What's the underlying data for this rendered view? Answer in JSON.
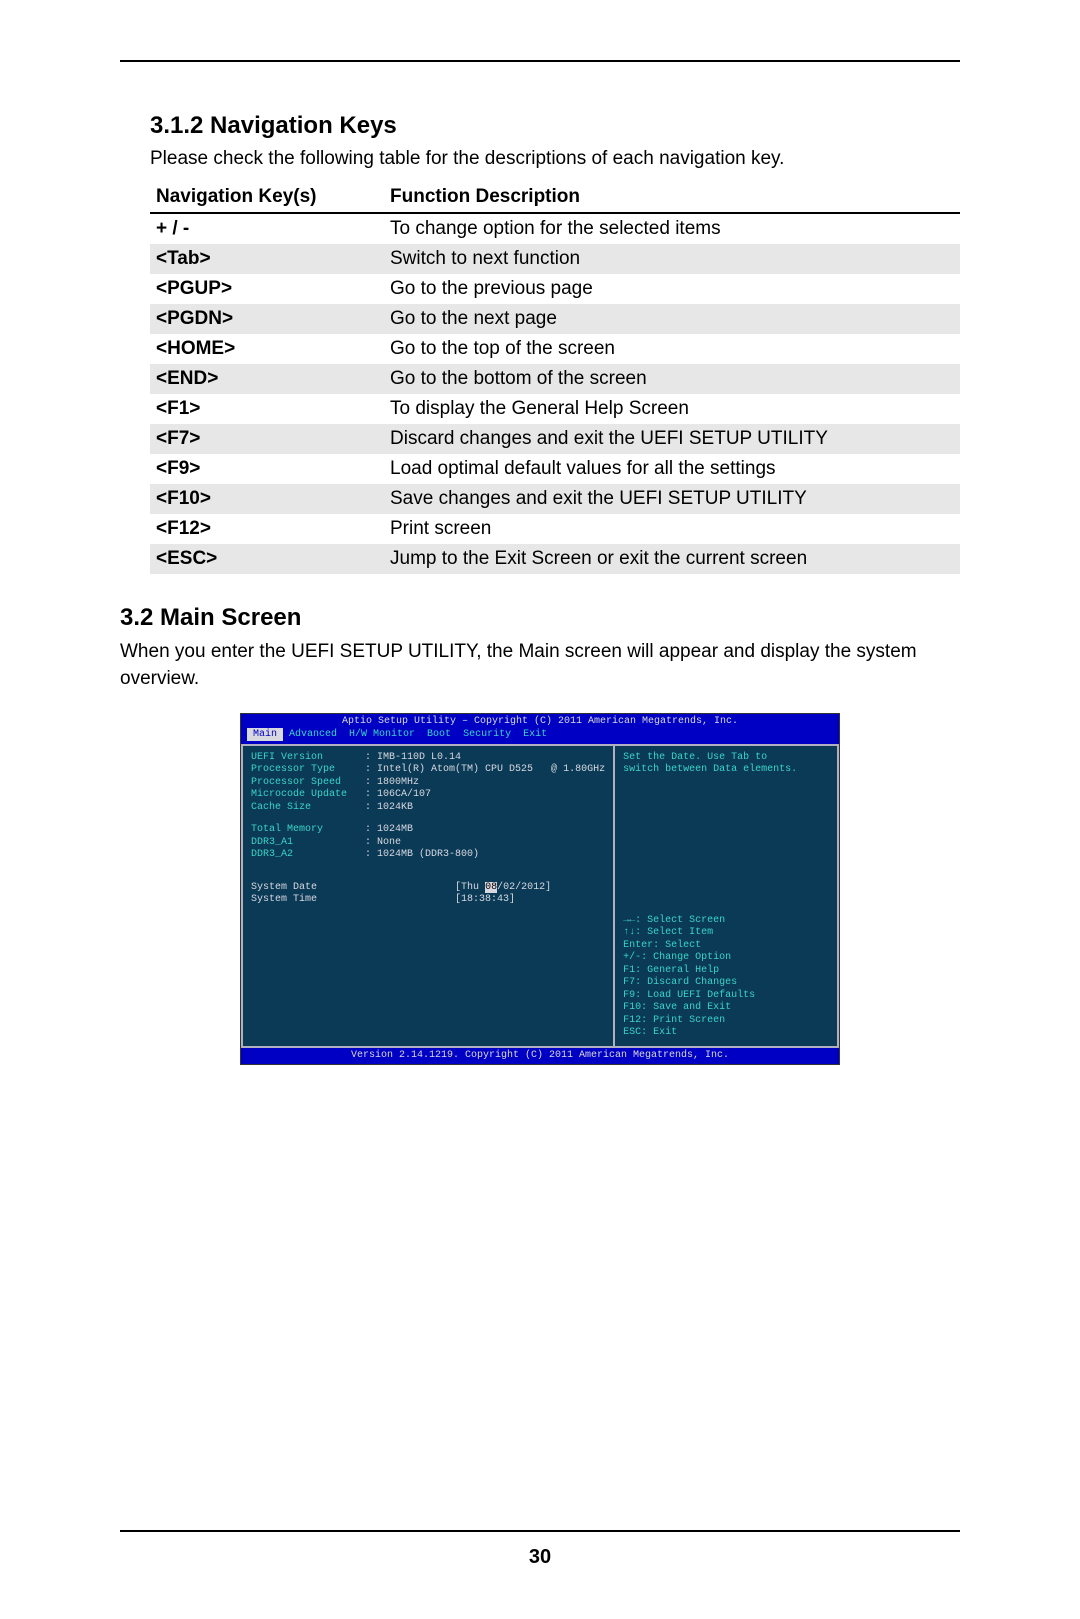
{
  "page_number": "30",
  "section312": {
    "heading": "3.1.2  Navigation Keys",
    "intro": "Please check the following table for the descriptions of each navigation key.",
    "table": {
      "head_key": "Navigation Key(s)",
      "head_desc": "Function Description",
      "rows": [
        {
          "key": " +  /  -",
          "desc": "To change option for the selected items"
        },
        {
          "key": "<Tab>",
          "desc": "Switch to next function"
        },
        {
          "key": "<PGUP>",
          "desc": "Go to the previous page"
        },
        {
          "key": "<PGDN>",
          "desc": "Go to the next page"
        },
        {
          "key": "<HOME>",
          "desc": "Go to the top of the screen"
        },
        {
          "key": "<END>",
          "desc": "Go to the bottom of the screen"
        },
        {
          "key": "<F1>",
          "desc": "To display the General Help Screen"
        },
        {
          "key": "<F7>",
          "desc": "Discard changes and exit the UEFI SETUP UTILITY"
        },
        {
          "key": "<F9>",
          "desc": "Load optimal default values for all the settings"
        },
        {
          "key": "<F10>",
          "desc": "Save changes and exit the UEFI SETUP UTILITY"
        },
        {
          "key": "<F12>",
          "desc": "Print screen"
        },
        {
          "key": "<ESC>",
          "desc": "Jump to the Exit Screen or exit the current screen"
        }
      ]
    }
  },
  "section32": {
    "heading": "3.2  Main Screen",
    "intro": "When you enter the UEFI SETUP UTILITY, the Main screen will appear and display the system overview."
  },
  "bios": {
    "title": "Aptio Setup Utility – Copyright (C) 2011 American Megatrends, Inc.",
    "menu": [
      "Main",
      "Advanced",
      "H/W Monitor",
      "Boot",
      "Security",
      "Exit"
    ],
    "active_menu": "Main",
    "left_rows": [
      {
        "label": "UEFI Version       ",
        "value": ": IMB-110D L0.14"
      },
      {
        "label": "Processor Type     ",
        "value": ": Intel(R) Atom(TM) CPU D525   @ 1.80GHz"
      },
      {
        "label": "Processor Speed    ",
        "value": ": 1800MHz"
      },
      {
        "label": "Microcode Update   ",
        "value": ": 106CA/107"
      },
      {
        "label": "Cache Size         ",
        "value": ": 1024KB"
      }
    ],
    "mem_rows": [
      {
        "label": "Total Memory       ",
        "value": ": 1024MB"
      },
      {
        "label": "DDR3_A1            ",
        "value": ": None"
      },
      {
        "label": "DDR3_A2            ",
        "value": ": 1024MB (DDR3-800)"
      }
    ],
    "sysdate_label": "System Date                       ",
    "sysdate_prefix": "[Thu ",
    "sysdate_caret": "08",
    "sysdate_suffix": "/02/2012]",
    "systime_label": "System Time                       ",
    "systime_value": "[18:38:43]",
    "right_help_top": "Set the Date. Use Tab to\nswitch between Data elements.",
    "right_help_keys": [
      "→←: Select Screen",
      "↑↓: Select Item",
      "Enter: Select",
      "+/-: Change Option",
      "F1: General Help",
      "F7: Discard Changes",
      "F9: Load UEFI Defaults",
      "F10: Save and Exit",
      "F12: Print Screen",
      "ESC: Exit"
    ],
    "version": "Version 2.14.1219. Copyright (C) 2011 American Megatrends, Inc."
  }
}
